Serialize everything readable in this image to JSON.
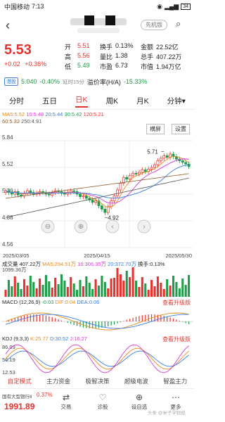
{
  "status": {
    "carrier": "中国移动",
    "time": "7:13",
    "battery": "34"
  },
  "header": {
    "account_btn": "先机版"
  },
  "quote": {
    "price": "5.53",
    "change": "+0.02",
    "change_pct": "+0.36%",
    "open_label": "开",
    "open": "5.51",
    "high_label": "高",
    "high": "5.56",
    "low_label": "低",
    "low": "5.49",
    "turnover_label": "换手",
    "turnover": "0.13%",
    "ratio_label": "量比",
    "ratio": "1.38",
    "pe_label": "市盈",
    "pe": "6.73",
    "amount_label": "金额",
    "amount": "22.52亿",
    "total_shares_label": "总手",
    "total_shares": "407.22万",
    "mktcap_label": "市值",
    "mktcap": "1.94万亿"
  },
  "ext": {
    "tag": "港股",
    "price": "5.040",
    "change": "-0.40%",
    "delay": "延时15分",
    "premium_label": "溢价率(H/A)",
    "premium": "-15.33%"
  },
  "tabs": [
    "分时",
    "五日",
    "日K",
    "周K",
    "月K",
    "分钟"
  ],
  "active_tab": "日K",
  "ma_legend": {
    "ma5": "MA5:5.52",
    "ma10": "10:5.48",
    "ma20": "20:5.44",
    "ma30": "30:5.42",
    "ma60": "60:5.32",
    "ma120": "120:5.21",
    "ma250": "250:4.91"
  },
  "chart_buttons": {
    "landscape": "横屏",
    "settings": "设置"
  },
  "chart_data": {
    "type": "candlestick",
    "y_ticks": [
      "5.84",
      "5.52",
      "5.20",
      "4.88",
      "4.56"
    ],
    "x_ticks": [
      "2025/03/05",
      "2025/04/15",
      "2025/05/30"
    ],
    "ylim": [
      4.56,
      5.84
    ],
    "annotations": [
      {
        "label": "5.71",
        "value": 5.71
      },
      {
        "label": "4.92",
        "value": 4.92
      }
    ],
    "closes": [
      5.24,
      5.22,
      5.2,
      5.23,
      5.19,
      5.18,
      5.21,
      5.24,
      5.22,
      5.2,
      5.21,
      5.23,
      5.22,
      5.2,
      5.19,
      5.22,
      5.24,
      5.23,
      5.21,
      5.2,
      5.22,
      5.24,
      5.23,
      5.2,
      5.17,
      5.18,
      5.15,
      5.13,
      5.1,
      5.12,
      5.06,
      5.02,
      4.98,
      5.05,
      5.12,
      5.18,
      5.25,
      5.33,
      5.4,
      5.38,
      5.42,
      5.45,
      5.44,
      5.46,
      5.49,
      5.47,
      5.5,
      5.52,
      5.55,
      5.6,
      5.63,
      5.66,
      5.64,
      5.68,
      5.65,
      5.62,
      5.6,
      5.58,
      5.56,
      5.53
    ]
  },
  "volume": {
    "label": "成交量",
    "value": "407.22万",
    "ma5": "MA5:294.51万",
    "ma10": "10:306.35万",
    "ma20": "20:372.70万",
    "turnover": "换手:0.13%",
    "axis_top": "1099.36万"
  },
  "macd": {
    "label": "MACD",
    "params": "(12,26,9)",
    "macd": "-0.03",
    "dif": "DIF:0.04",
    "dea": "DEA:0.06",
    "upgrade": "查看升级版"
  },
  "kdj": {
    "label": "KDJ",
    "params": "(9,3,3)",
    "k": "K:25.77",
    "d": "D:30.52",
    "j": "J:16.27",
    "upgrade": "查看升级版",
    "axis": [
      "86.09",
      "56.19",
      "12.53"
    ]
  },
  "ind_tabs": [
    "自定模式",
    "主力资金",
    "极智决策",
    "超级电波",
    "智盈主力"
  ],
  "ind_active": "自定模式",
  "bottom": {
    "index_name": "国有大型银行Ⅱ",
    "index_change": "0.37%",
    "index_value": "1991.89",
    "nav": [
      "交易",
      "诊股",
      "设自选",
      "更多"
    ],
    "watermark": "头条 @米子学财经"
  }
}
